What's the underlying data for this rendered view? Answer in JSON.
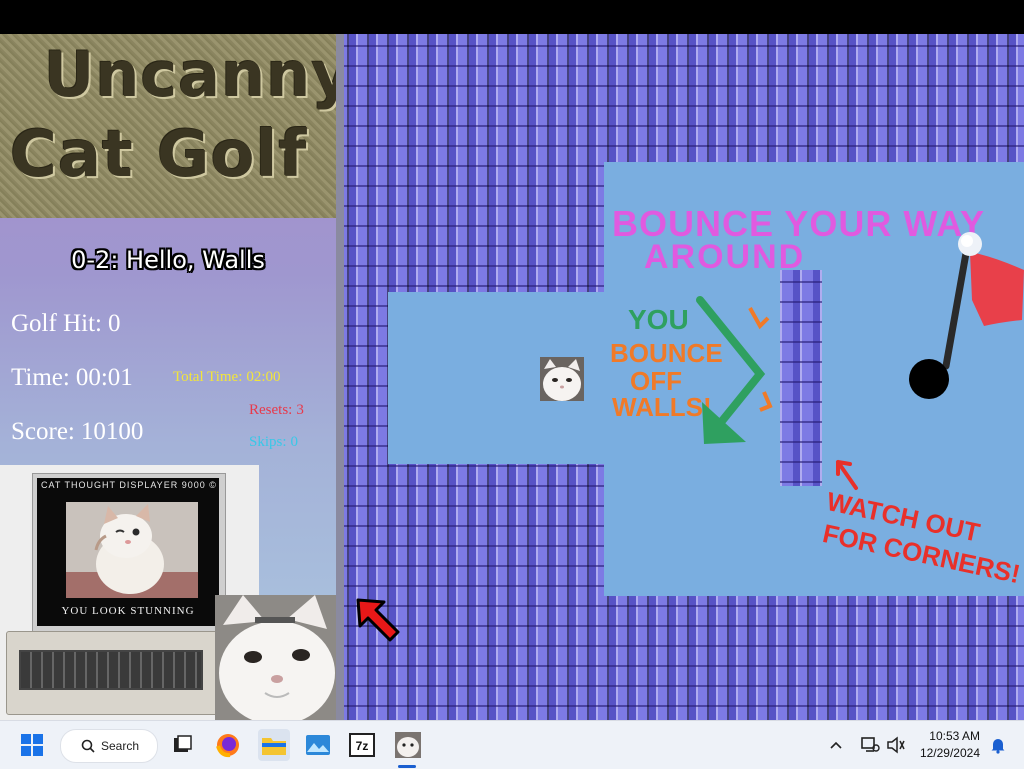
{
  "hud": {
    "logo_line1": "Uncanny",
    "logo_line2": "Cat Golf",
    "level_title": "0-2: Hello, Walls",
    "golf_hit_label": "Golf Hit:",
    "golf_hit_value": "0",
    "time_label": "Time:",
    "time_value": "00:01",
    "score_label": "Score:",
    "score_value": "10100",
    "total_time_label": "Total Time:",
    "total_time_value": "02:00",
    "resets_label": "Resets:",
    "resets_value": "3",
    "skips_label": "Skips:",
    "skips_value": "0",
    "colors": {
      "total_time": "#f2e53a",
      "resets": "#e8394a",
      "skips": "#38c8e8"
    }
  },
  "computer": {
    "screen_title": "CAT THOUGHT DISPLAYER 9000 ©",
    "screen_caption": "YOU LOOK STUNNING"
  },
  "game": {
    "headline_line1": "BOUNCE YOUR WAY",
    "headline_line2": "AROUND",
    "green_note": "YOU",
    "orange_note_line1": "BOUNCE",
    "orange_note_line2": "OFF",
    "orange_note_line3": "WALLS!",
    "red_note_line1": "WATCH OUT",
    "red_note_line2": "FOR CORNERS!",
    "colors": {
      "floor": "#7aaee0",
      "wall": "#7d7ae4",
      "headline": "#e05ae0",
      "green": "#2fa060",
      "orange": "#f07a28",
      "red": "#e8302a",
      "flag": "#e8404a"
    }
  },
  "taskbar": {
    "search_label": "Search",
    "time": "10:53 AM",
    "date": "12/29/2024",
    "icons": [
      "windows-start-icon",
      "search-icon",
      "task-view-icon",
      "firefox-icon",
      "file-explorer-icon",
      "photos-icon",
      "7zip-icon",
      "cat-app-icon",
      "chevron-up-icon",
      "network-icon",
      "volume-icon",
      "notification-bell-icon"
    ]
  }
}
